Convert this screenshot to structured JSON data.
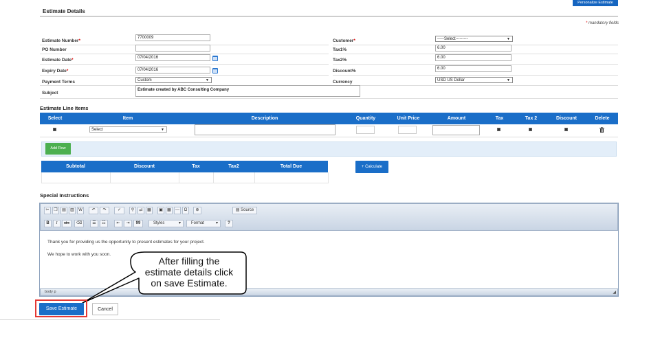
{
  "header": {
    "title": "Estimate Details",
    "personalize_button": "Personalize Estimate",
    "mandatory_note": "mandatory fields",
    "mandatory_star": "*"
  },
  "form": {
    "estimate_number": {
      "label": "Estimate Number",
      "value": "7700009"
    },
    "po_number": {
      "label": "PO Number",
      "value": ""
    },
    "estimate_date": {
      "label": "Estimate Date",
      "value": "07/04/2016"
    },
    "expiry_date": {
      "label": "Expiry Date",
      "value": "07/04/2016"
    },
    "payment_terms": {
      "label": "Payment Terms",
      "value": "Custom"
    },
    "subject": {
      "label": "Subject",
      "value": "Estimate  created by ABC Consulting Company"
    },
    "customer": {
      "label": "Customer",
      "value": "-----Select---------"
    },
    "tax1": {
      "label": "Tax1%",
      "value": "6.00"
    },
    "tax2": {
      "label": "Tax2%",
      "value": "6.00"
    },
    "discount": {
      "label": "Discount%",
      "value": "6.00"
    },
    "currency": {
      "label": "Currency",
      "value": "USD US Dollar"
    },
    "required_marker": "*"
  },
  "line_items": {
    "title": "Estimate Line Items",
    "columns": [
      "Select",
      "Item",
      "Description",
      "Quantity",
      "Unit Price",
      "Amount",
      "Tax",
      "Tax 2",
      "Discount",
      "Delete"
    ],
    "row": {
      "item_select": "Select"
    },
    "add_row_button": "Add Row"
  },
  "totals": {
    "columns": [
      "Subtotal",
      "Discount",
      "Tax",
      "Tax2",
      "Total Due"
    ],
    "calculate_button": "+ Calculate"
  },
  "instructions": {
    "title": "Special Instructions",
    "toolbar": {
      "source_label": "Source",
      "styles_label": "Styles",
      "format_label": "Format",
      "help_label": "?",
      "bold": "B",
      "italic": "I",
      "strike": "abc",
      "quote": "99"
    },
    "content": [
      "Thank you for providing us the opportunity to present estimates for your project.",
      "We hope to work with you soon."
    ],
    "status_path": "body  p"
  },
  "callout": {
    "lines": [
      "After filling the",
      "estimate details click",
      "on save Estimate."
    ]
  },
  "actions": {
    "save_button": "Save Estimate",
    "cancel_button": "Cancel"
  },
  "colors": {
    "accent": "#1a6ec8",
    "green": "#4caf50",
    "highlight": "#e53935"
  }
}
